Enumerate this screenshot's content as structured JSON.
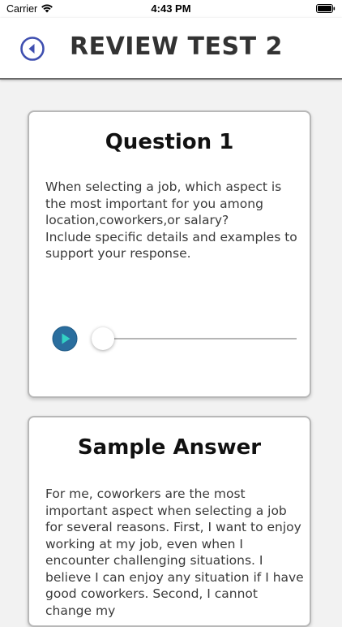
{
  "status_bar": {
    "carrier": "Carrier",
    "time": "4:43 PM",
    "wifi_icon": "wifi-icon",
    "battery_icon": "battery-full-icon"
  },
  "header": {
    "title": "REVIEW TEST 2",
    "back_icon": "chevron-left-circle-icon",
    "accent_color": "#3f4fb0"
  },
  "question_card": {
    "title": "Question 1",
    "text": "When selecting a job, which aspect is the most important for you among location,coworkers,or salary?\nInclude specific details and examples to support your response.",
    "audio": {
      "play_icon": "play-icon",
      "progress": 0.0,
      "play_button_color": "#2a6e9e",
      "play_triangle_color": "#33d1c4"
    }
  },
  "answer_card": {
    "title": "Sample Answer",
    "text": "For me, coworkers are the most important aspect when selecting a job for several reasons. First, I want to enjoy working at my job, even when I encounter challenging situations. I believe I can enjoy any situation if I have good coworkers. Second, I cannot change my"
  }
}
